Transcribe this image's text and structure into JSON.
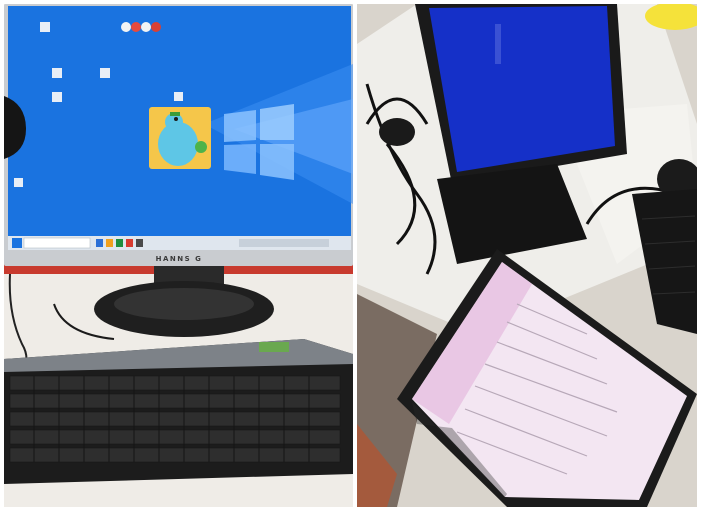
{
  "photo_left": {
    "monitor_brand": "HANNS G",
    "desktop_color": "#1a73e0",
    "taskbar_color": "#dfe6ee"
  },
  "photo_right": {
    "tablet_screen_color": "#1530c8",
    "settings_screen_color": "#f3e6f2"
  }
}
